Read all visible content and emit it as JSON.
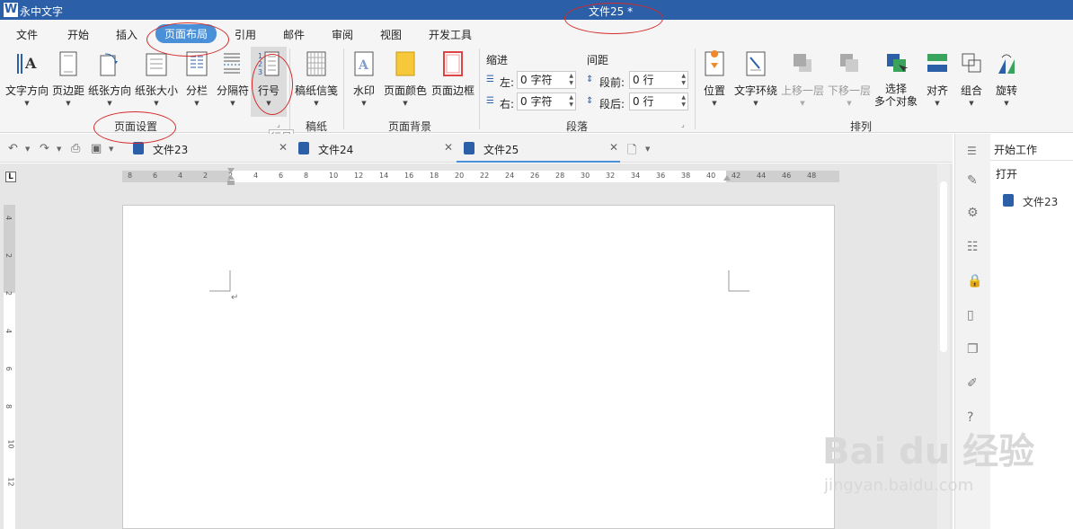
{
  "titlebar": {
    "app_name": "永中文字",
    "doc_title": "文件25 *"
  },
  "menu": [
    "文件",
    "开始",
    "插入",
    "页面布局",
    "引用",
    "邮件",
    "审阅",
    "视图",
    "开发工具"
  ],
  "menu_active": "页面布局",
  "ribbon": {
    "page_setup": {
      "text_direction": "文字方向",
      "margins": "页边距",
      "orientation": "纸张方向",
      "size": "纸张大小",
      "columns": "分栏",
      "breaks": "分隔符",
      "line_numbers": "行号",
      "group_label": "页面设置"
    },
    "manuscript": {
      "paper_letter": "稿纸信笺",
      "group_label": "稿纸"
    },
    "background": {
      "watermark": "水印",
      "page_color": "页面颜色",
      "page_border": "页面边框",
      "group_label": "页面背景"
    },
    "paragraph": {
      "indent_title": "缩进",
      "left_label": "左:",
      "left_value": "0 字符",
      "right_label": "右:",
      "right_value": "0 字符",
      "spacing_title": "间距",
      "before_label": "段前:",
      "before_value": "0 行",
      "after_label": "段后:",
      "after_value": "0 行",
      "group_label": "段落"
    },
    "arrange": {
      "position": "位置",
      "wrap": "文字环绕",
      "bring_forward": "上移一层",
      "send_backward": "下移一层",
      "select_multi_1": "选择",
      "select_multi_2": "多个对象",
      "align": "对齐",
      "group": "组合",
      "rotate": "旋转",
      "group_label": "排列"
    },
    "tooltip": "行号"
  },
  "tabs": [
    {
      "name": "文件23",
      "active": false
    },
    {
      "name": "文件24",
      "active": false
    },
    {
      "name": "文件25",
      "active": true
    }
  ],
  "ruler": {
    "h_ticks": [
      "8",
      "6",
      "4",
      "2",
      "2",
      "4",
      "6",
      "8",
      "10",
      "12",
      "14",
      "16",
      "18",
      "20",
      "22",
      "24",
      "26",
      "28",
      "30",
      "32",
      "34",
      "36",
      "38",
      "40",
      "42",
      "44",
      "46",
      "48"
    ],
    "v_ticks": [
      "4",
      "2",
      "2",
      "4",
      "6",
      "8",
      "10",
      "12"
    ],
    "corner": "L"
  },
  "sidepanel": {
    "header": "开始工作",
    "open": "打开",
    "recent_file": "文件23"
  },
  "watermark": {
    "brand": "Bai du 经验",
    "url": "jingyan.baidu.com"
  },
  "colors": {
    "titlebar": "#2b5fa8",
    "accent": "#4a90d9",
    "annotation": "#d42a2a"
  }
}
